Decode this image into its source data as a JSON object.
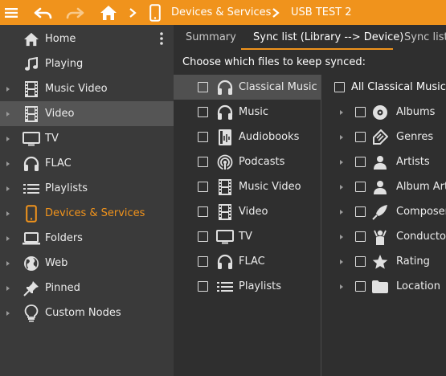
{
  "topbar": {
    "breadcrumb_device_section": "Devices & Services",
    "breadcrumb_device": "USB TEST 2",
    "bg_color": "#f0931c"
  },
  "sidebar": {
    "items": [
      {
        "label": "Home",
        "icon": "home-icon",
        "has_arrow": false
      },
      {
        "label": "Playing",
        "icon": "music-note-icon",
        "has_arrow": false
      },
      {
        "label": "Music Video",
        "icon": "film-icon",
        "has_arrow": true
      },
      {
        "label": "Video",
        "icon": "film-icon",
        "has_arrow": true,
        "selected": true
      },
      {
        "label": "TV",
        "icon": "tv-icon",
        "has_arrow": true
      },
      {
        "label": "FLAC",
        "icon": "headphones-icon",
        "has_arrow": true
      },
      {
        "label": "Playlists",
        "icon": "list-icon",
        "has_arrow": true
      },
      {
        "label": "Devices & Services",
        "icon": "phone-icon",
        "has_arrow": true,
        "active": true
      },
      {
        "label": "Folders",
        "icon": "laptop-icon",
        "has_arrow": true
      },
      {
        "label": "Web",
        "icon": "globe-icon",
        "has_arrow": true
      },
      {
        "label": "Pinned",
        "icon": "pin-icon",
        "has_arrow": true
      },
      {
        "label": "Custom Nodes",
        "icon": "lightbulb-icon",
        "has_arrow": true
      }
    ]
  },
  "tabs": [
    {
      "label": "Summary",
      "active": false
    },
    {
      "label": "Sync list (Library --> Device)",
      "active": true
    },
    {
      "label": "Sync list",
      "active": false
    }
  ],
  "sync": {
    "instruction": "Choose which files to keep synced:",
    "collections": [
      {
        "label": "Classical Music",
        "icon": "headphones-icon",
        "selected": true
      },
      {
        "label": "Music",
        "icon": "headphones-icon"
      },
      {
        "label": "Audiobooks",
        "icon": "audiobook-icon"
      },
      {
        "label": "Podcasts",
        "icon": "podcast-icon"
      },
      {
        "label": "Music Video",
        "icon": "film-icon"
      },
      {
        "label": "Video",
        "icon": "film-icon"
      },
      {
        "label": "TV",
        "icon": "tv-icon"
      },
      {
        "label": "FLAC",
        "icon": "headphones-icon"
      },
      {
        "label": "Playlists",
        "icon": "list-icon"
      }
    ],
    "tree_header": "All Classical Music",
    "tree": [
      {
        "label": "Albums",
        "icon": "disc-icon"
      },
      {
        "label": "Genres",
        "icon": "tag-icon"
      },
      {
        "label": "Artists",
        "icon": "person-icon"
      },
      {
        "label": "Album Artists",
        "icon": "person-icon"
      },
      {
        "label": "Composers",
        "icon": "quill-icon"
      },
      {
        "label": "Conductors",
        "icon": "conductor-icon"
      },
      {
        "label": "Rating",
        "icon": "star-icon"
      },
      {
        "label": "Location",
        "icon": "folder-icon"
      }
    ]
  },
  "colors": {
    "accent": "#f0931c",
    "sidebar_bg": "#3a3a3a",
    "main_bg": "#2f2f2f",
    "selected_bg": "#505050"
  }
}
